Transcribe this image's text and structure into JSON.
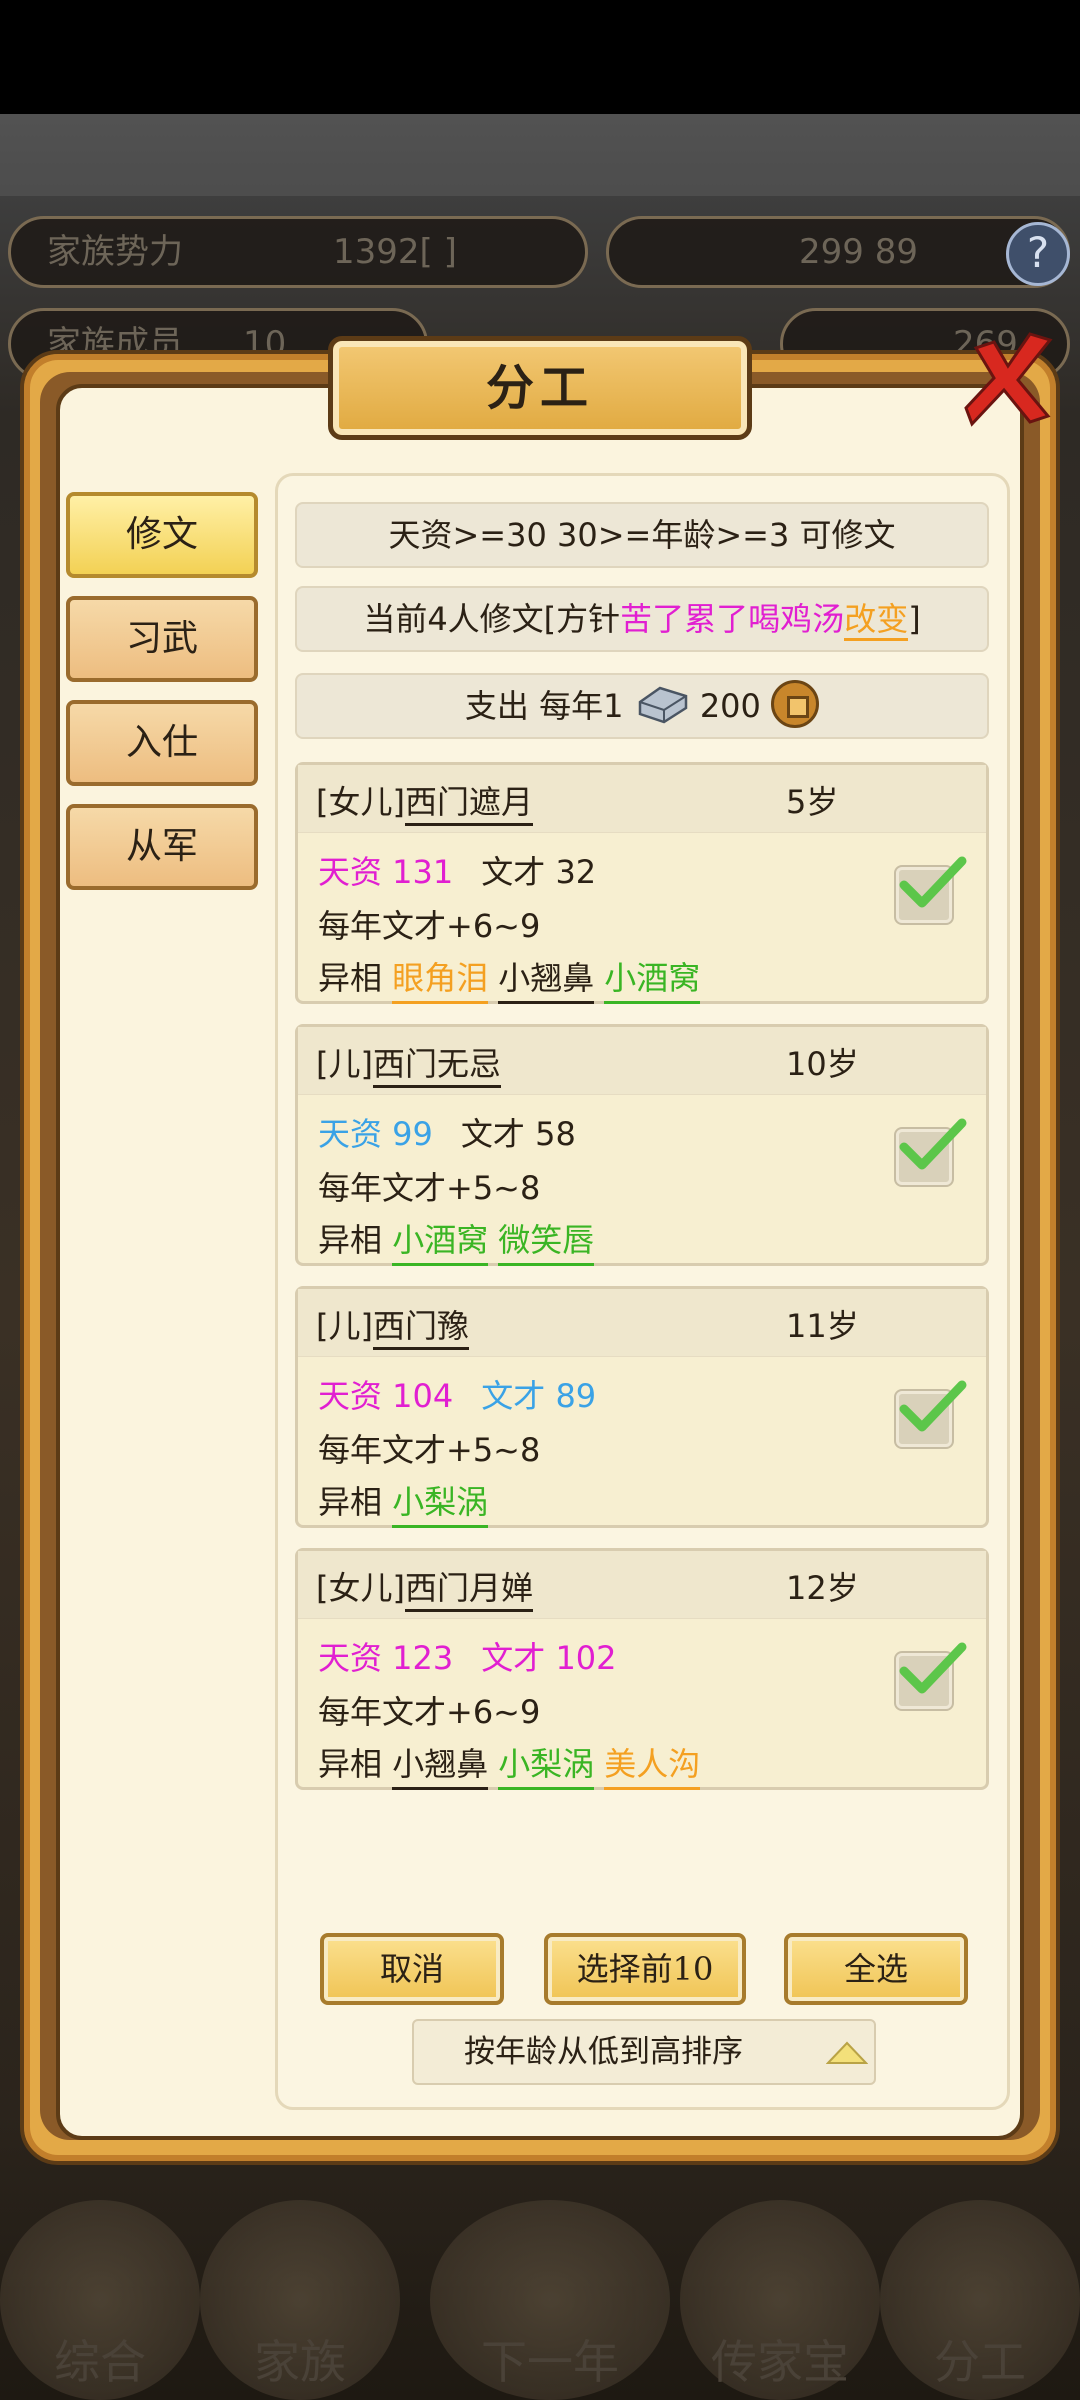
{
  "background": {
    "stats": [
      {
        "label": "家族势力",
        "value": "1392[ ]"
      },
      {
        "label": "",
        "value": "299 89"
      },
      {
        "label": "家族成员",
        "value": "10"
      },
      {
        "label": "",
        "value": "269"
      }
    ],
    "help": "?",
    "nav": [
      "综合",
      "家族",
      "下一年",
      "传家宝",
      "分工"
    ]
  },
  "dialog": {
    "title": "分工",
    "tabs": [
      "修文",
      "习武",
      "入仕",
      "从军"
    ],
    "active_tab": 0,
    "requirement": "天资>=30 30>=年龄>=3 可修文",
    "status": {
      "prefix": "当前4人修文[方针",
      "policy": "苦了累了喝鸡汤",
      "change": "改变",
      "suffix": "]"
    },
    "cost": {
      "label": "支出 每年1",
      "amount": "200"
    },
    "members": [
      {
        "name_prefix": "[女儿]",
        "name": "西门遮月",
        "age": "5岁",
        "talent": "天资 131",
        "talent_color": "#e11fd1",
        "skill": "文才 32",
        "skill_color": "#2b2115",
        "yearly": "每年文才+6~9",
        "traits_label": "异相",
        "traits": [
          {
            "text": "眼角泪",
            "color": "#f4a021"
          },
          {
            "text": "小翘鼻",
            "color": "#2b2115"
          },
          {
            "text": "小酒窝",
            "color": "#3ab524"
          }
        ],
        "checked": true
      },
      {
        "name_prefix": "[儿]",
        "name": "西门无忌",
        "age": "10岁",
        "talent": "天资 99",
        "talent_color": "#3aa2e6",
        "skill": "文才 58",
        "skill_color": "#2b2115",
        "yearly": "每年文才+5~8",
        "traits_label": "异相",
        "traits": [
          {
            "text": "小酒窝",
            "color": "#3ab524"
          },
          {
            "text": "微笑唇",
            "color": "#3ab524"
          }
        ],
        "checked": true
      },
      {
        "name_prefix": "[儿]",
        "name": "西门豫",
        "age": "11岁",
        "talent": "天资 104",
        "talent_color": "#e11fd1",
        "skill": "文才 89",
        "skill_color": "#3aa2e6",
        "yearly": "每年文才+5~8",
        "traits_label": "异相",
        "traits": [
          {
            "text": "小梨涡",
            "color": "#3ab524"
          }
        ],
        "checked": true
      },
      {
        "name_prefix": "[女儿]",
        "name": "西门月婵",
        "age": "12岁",
        "talent": "天资 123",
        "talent_color": "#e11fd1",
        "skill": "文才 102",
        "skill_color": "#e11fd1",
        "yearly": "每年文才+6~9",
        "traits_label": "异相",
        "traits": [
          {
            "text": "小翘鼻",
            "color": "#2b2115"
          },
          {
            "text": "小梨涡",
            "color": "#3ab524"
          },
          {
            "text": "美人沟",
            "color": "#f4a021"
          }
        ],
        "checked": true
      }
    ],
    "buttons": {
      "cancel": "取消",
      "select_top": "选择前10",
      "select_all": "全选"
    },
    "sort": {
      "label": "按年龄从低到高排序"
    }
  }
}
